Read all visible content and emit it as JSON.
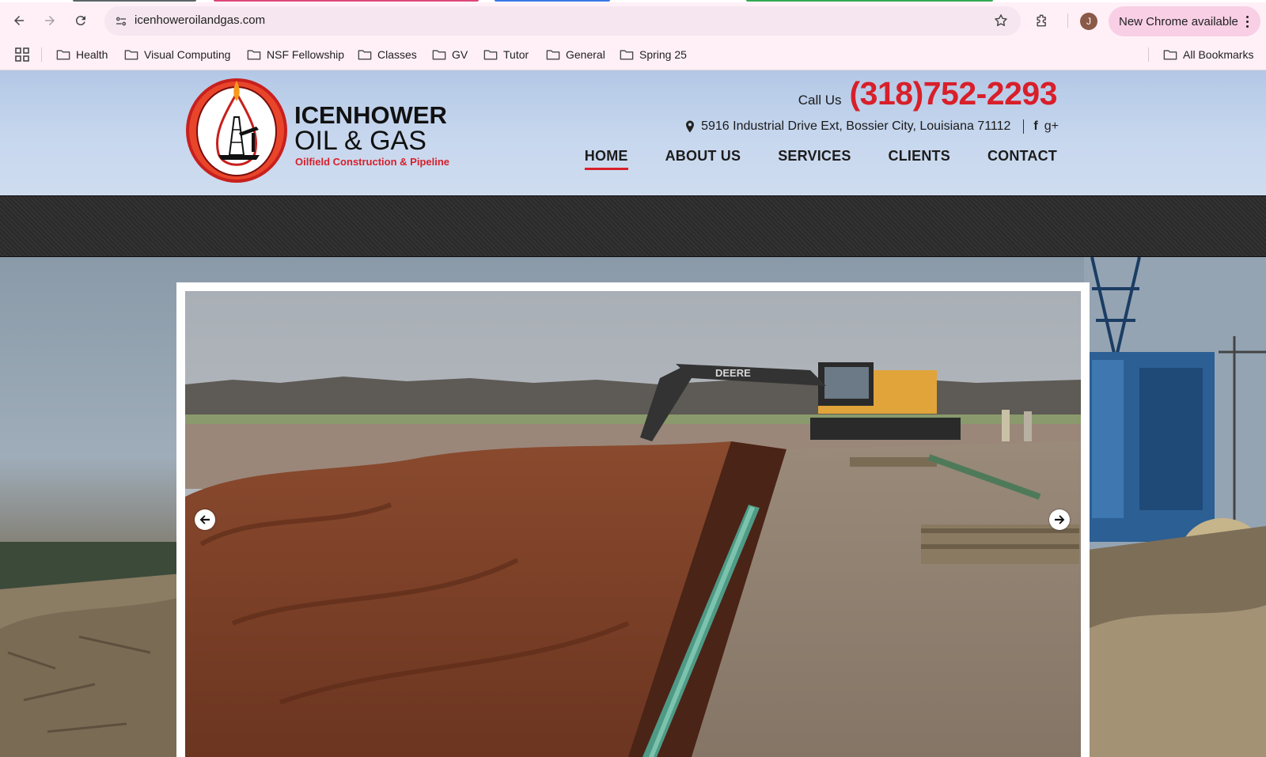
{
  "browser": {
    "url": "icenhoweroilandgas.com",
    "update_label": "New Chrome available",
    "profile_initial": "J",
    "tab_colors": [
      "#5f6368",
      "#e0457b",
      "#3b78e7",
      "#34a853"
    ],
    "bookmarks": [
      {
        "label": "Health"
      },
      {
        "label": "Visual Computing"
      },
      {
        "label": "NSF Fellowship"
      },
      {
        "label": "Classes"
      },
      {
        "label": "GV"
      },
      {
        "label": "Tutor"
      },
      {
        "label": "General"
      },
      {
        "label": "Spring 25"
      }
    ],
    "all_bookmarks_label": "All Bookmarks"
  },
  "site": {
    "logo": {
      "line1": "ICENHOWER",
      "line2": "OIL & GAS",
      "tagline": "Oilfield Construction & Pipeline"
    },
    "call_label": "Call Us",
    "phone": "(318)752-2293",
    "address": "5916 Industrial Drive Ext, Bossier City, Louisiana 71112",
    "social": {
      "facebook": "f",
      "google_plus": "g+"
    },
    "nav": [
      {
        "label": "HOME",
        "active": true
      },
      {
        "label": "ABOUT US",
        "active": false
      },
      {
        "label": "SERVICES",
        "active": false
      },
      {
        "label": "CLIENTS",
        "active": false
      },
      {
        "label": "CONTACT",
        "active": false
      }
    ],
    "slide_excavator_text": "DEERE",
    "accent_color": "#d81f2a"
  }
}
